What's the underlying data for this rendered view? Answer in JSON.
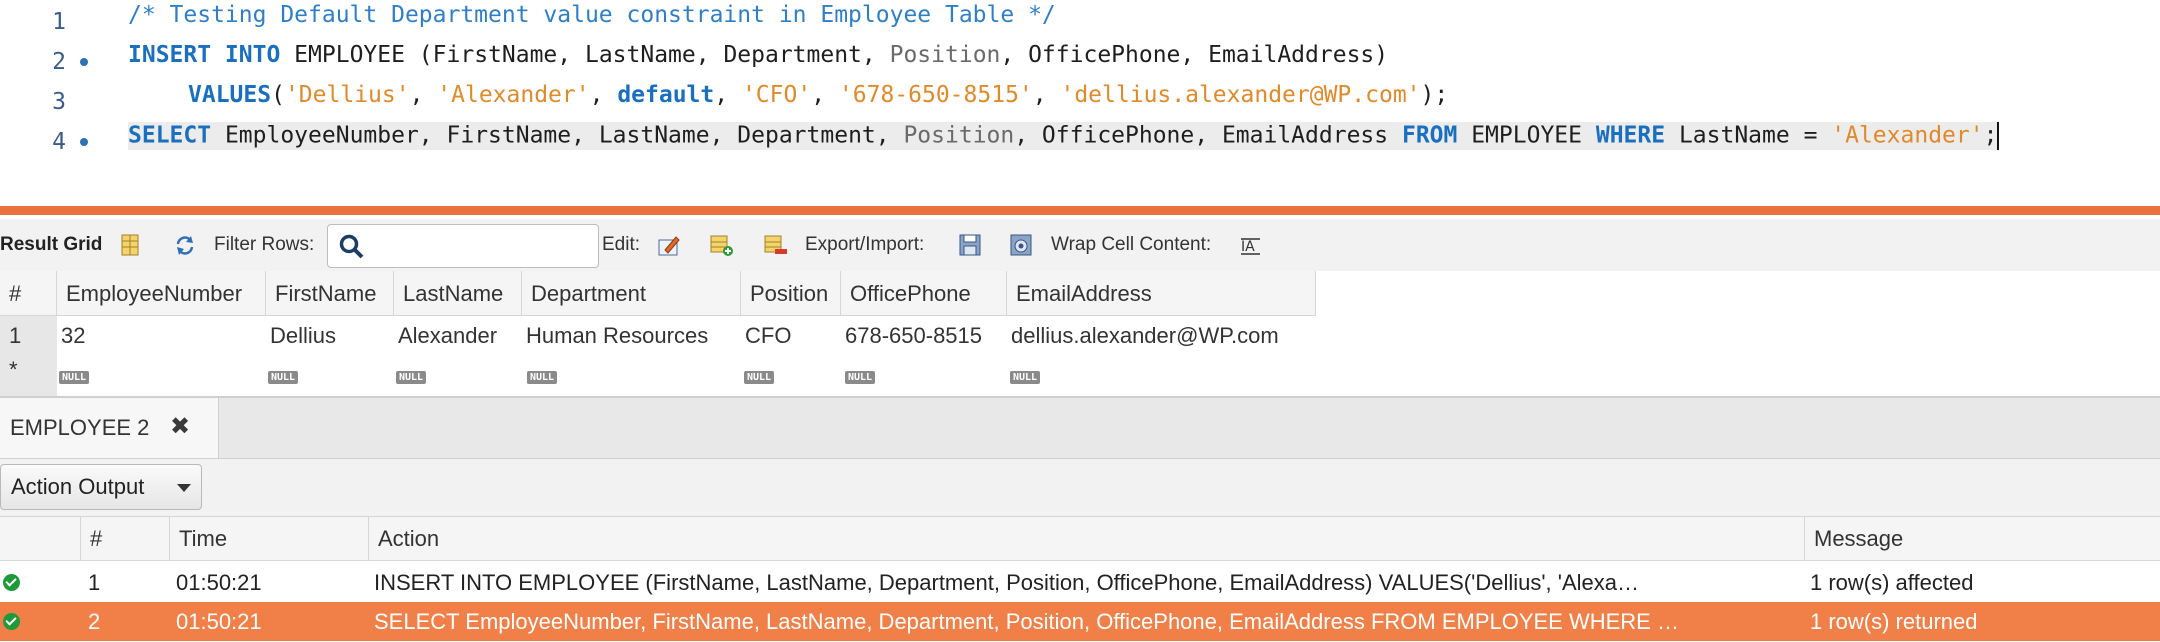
{
  "editor": {
    "lines": [
      {
        "number": "1",
        "text": "/* Testing Default Department value constraint in Employee Table */"
      },
      {
        "number": "2",
        "kw1": "INSERT INTO",
        "t1": " EMPLOYEE (FirstName, LastName, Department, ",
        "fn1": "Position",
        "t2": ", OfficePhone, EmailAddress)"
      },
      {
        "number": "3",
        "kw1": "VALUES",
        "t1": "(",
        "s1": "'Dellius'",
        "t2": ", ",
        "s2": "'Alexander'",
        "t3": ", ",
        "kw2": "default",
        "t4": ", ",
        "s3": "'CFO'",
        "t5": ", ",
        "s4": "'678-650-8515'",
        "t6": ", ",
        "s5": "'dellius.alexander@WP.com'",
        "t7": ");"
      },
      {
        "number": "4",
        "kw1": "SELECT",
        "t1": " EmployeeNumber, FirstName, LastName, Department, ",
        "fn1": "Position",
        "t2": ", OfficePhone, EmailAddress ",
        "kw2": "FROM",
        "t3": " EMPLOYEE ",
        "kw3": "WHERE",
        "t4": " LastName = ",
        "s1": "'Alexander'",
        "t5": ";"
      }
    ]
  },
  "toolbar": {
    "result_grid": "Result Grid",
    "filter_rows": "Filter Rows:",
    "edit": "Edit:",
    "export_import": "Export/Import:",
    "wrap_cell": "Wrap Cell Content:",
    "search_placeholder": ""
  },
  "grid": {
    "columns": [
      "#",
      "EmployeeNumber",
      "FirstName",
      "LastName",
      "Department",
      "Position",
      "OfficePhone",
      "EmailAddress"
    ],
    "rows": [
      [
        "1",
        "32",
        "Dellius",
        "Alexander",
        "Human Resources",
        "CFO",
        "678-650-8515",
        "dellius.alexander@WP.com"
      ]
    ],
    "new_row_marker": "*",
    "null_label": "NULL"
  },
  "tabs": [
    {
      "label": "EMPLOYEE 2",
      "close": "✖"
    }
  ],
  "output": {
    "selector": "Action Output",
    "columns": [
      "",
      "#",
      "Time",
      "Action",
      "Message"
    ],
    "rows": [
      {
        "num": "1",
        "time": "01:50:21",
        "action": "INSERT INTO EMPLOYEE (FirstName, LastName, Department, Position, OfficePhone, EmailAddress)    VALUES('Dellius', 'Alexa…",
        "message": "1 row(s) affected"
      },
      {
        "num": "2",
        "time": "01:50:21",
        "action": "SELECT EmployeeNumber, FirstName, LastName, Department, Position, OfficePhone, EmailAddress FROM EMPLOYEE WHERE …",
        "message": "1 row(s) returned"
      }
    ]
  },
  "colors": {
    "accent": "#e9713f",
    "selected_row": "#f07f48",
    "keyword": "#1a6fbf",
    "string": "#e08a2a",
    "success": "#1e9a3a"
  }
}
